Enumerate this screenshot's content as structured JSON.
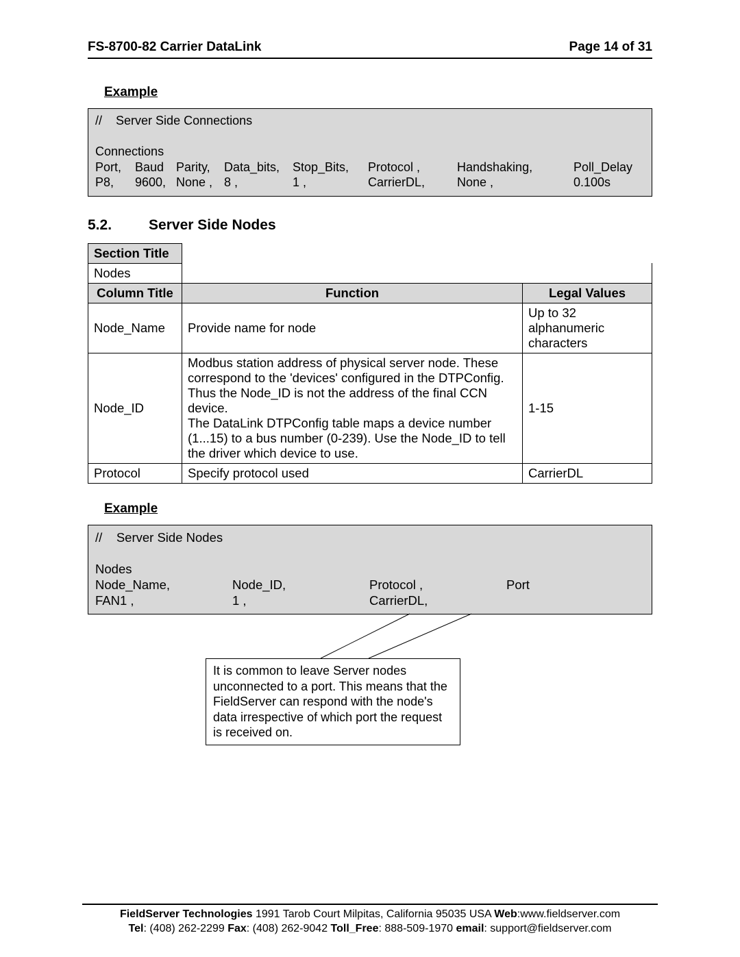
{
  "header": {
    "doc_id": "FS-8700-82 Carrier DataLink",
    "page_label": "Page 14 of 31"
  },
  "example1": {
    "heading": "Example",
    "comment_slashes": "//",
    "comment_text": "Server Side Connections",
    "section_word": "Connections",
    "hdr": {
      "c0": "Port,",
      "c1": "Baud",
      "c2": "Parity,",
      "c3": "Data_bits,",
      "c4": "Stop_Bits,",
      "c5": "Protocol ,",
      "c6": "Handshaking,",
      "c7": "Poll_Delay"
    },
    "val": {
      "c0": "P8,",
      "c1": "9600,",
      "c2": "None ,",
      "c3": "8          ,",
      "c4": "1          ,",
      "c5": "CarrierDL,",
      "c6": "None          ,",
      "c7": "0.100s"
    }
  },
  "section52": {
    "num": "5.2.",
    "title": "Server Side Nodes",
    "section_title_label": "Section Title",
    "section_title_value": "Nodes",
    "columns": {
      "c0": "Column Title",
      "c1": "Function",
      "c2": "Legal Values"
    },
    "rows": [
      {
        "title": "Node_Name",
        "func": "Provide name for node",
        "legal": "Up to 32 alphanumeric characters"
      },
      {
        "title": "Node_ID",
        "func": "Modbus station address of physical server node. These correspond to the 'devices' configured in the DTPConfig. Thus the Node_ID is not the address of the final CCN device.\nThe DataLink DTPConfig table maps a device number (1...15) to a bus number (0-239). Use the Node_ID to tell the driver which device to use.",
        "legal": "1-15"
      },
      {
        "title": "Protocol",
        "func": "Specify protocol used",
        "legal": "CarrierDL"
      }
    ]
  },
  "example2": {
    "heading": "Example",
    "comment_slashes": "//",
    "comment_text": "Server Side Nodes",
    "section_word": "Nodes",
    "hdr": {
      "c0": "Node_Name,",
      "c1": "Node_ID,",
      "c2": "Protocol ,",
      "c3": "Port"
    },
    "val": {
      "c0": "FAN1       ,",
      "c1": "1          ,",
      "c2": "CarrierDL,",
      "c3": ""
    }
  },
  "callout": {
    "text": "It is common to leave Server nodes unconnected to a port. This means that the FieldServer can respond with the node's data irrespective of which port the request is received on."
  },
  "footer": {
    "company": "FieldServer Technologies",
    "addr": " 1991 Tarob Court Milpitas, California 95035 USA  ",
    "web_label": "Web",
    "web_val": ":www.fieldserver.com",
    "tel_label": "Tel",
    "tel_val": ": (408) 262-2299  ",
    "fax_label": "Fax",
    "fax_val": ": (408) 262-9042   ",
    "toll_label": "Toll_Free",
    "toll_val": ": 888-509-1970   ",
    "email_label": "email",
    "email_val": ": support@fieldserver.com"
  }
}
